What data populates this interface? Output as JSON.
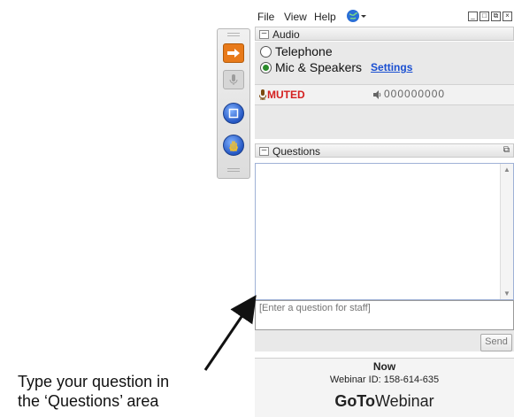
{
  "menu": {
    "file": "File",
    "view": "View",
    "help": "Help"
  },
  "audio": {
    "title": "Audio",
    "telephone_label": "Telephone",
    "mic_label": "Mic & Speakers",
    "settings_link": "Settings",
    "status": "MUTED",
    "level_display": "000000000",
    "selected": "Mic & Speakers"
  },
  "questions": {
    "title": "Questions",
    "input_placeholder": "[Enter a question for staff]",
    "send_label": "Send"
  },
  "footer": {
    "status": "Now",
    "webinar_id": "Webinar ID: 158-614-635",
    "brand_bold": "GoTo",
    "brand_rest": "Webinar"
  },
  "annotation": {
    "line1": "Type your question in",
    "line2": "the ‘Questions’ area"
  },
  "colors": {
    "accent_orange": "#e87a1a",
    "muted_red": "#d42020",
    "link_blue": "#1a4fd1"
  }
}
